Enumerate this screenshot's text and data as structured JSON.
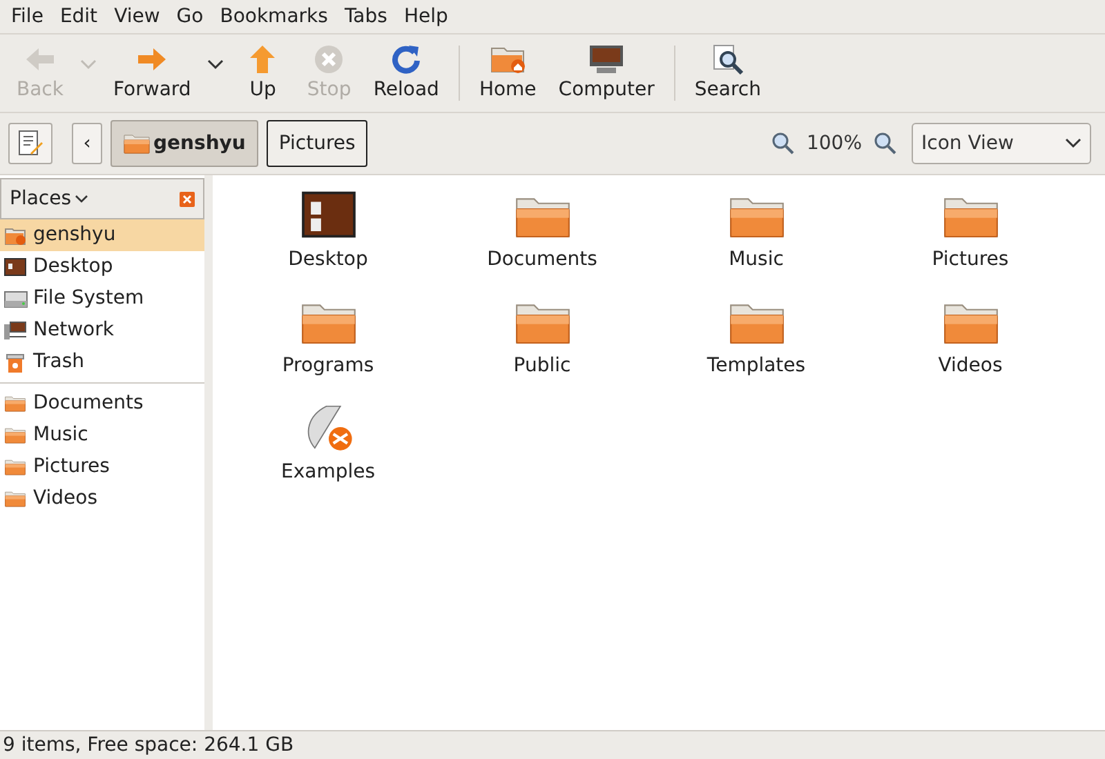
{
  "menu": [
    "File",
    "Edit",
    "View",
    "Go",
    "Bookmarks",
    "Tabs",
    "Help"
  ],
  "toolbar": [
    {
      "kind": "back",
      "label": "Back",
      "disabled": true,
      "dropdown": true
    },
    {
      "kind": "forward",
      "label": "Forward",
      "disabled": false,
      "dropdown": true
    },
    {
      "kind": "up",
      "label": "Up",
      "disabled": false,
      "dropdown": false
    },
    {
      "kind": "stop",
      "label": "Stop",
      "disabled": true,
      "dropdown": false
    },
    {
      "kind": "reload",
      "label": "Reload",
      "disabled": false,
      "dropdown": false
    },
    {
      "kind": "home",
      "label": "Home",
      "disabled": false,
      "dropdown": false
    },
    {
      "kind": "computer",
      "label": "Computer",
      "disabled": false,
      "dropdown": false
    },
    {
      "kind": "search",
      "label": "Search",
      "disabled": false,
      "dropdown": false
    }
  ],
  "location": {
    "back_arrow": "‹",
    "crumbs": [
      {
        "label": "genshyu",
        "selected": true
      },
      {
        "label": "Pictures",
        "selected": false
      }
    ],
    "zoom": "100%",
    "view": "Icon View"
  },
  "sidebar": {
    "title": "Places",
    "items": [
      {
        "kind": "home",
        "label": "genshyu",
        "selected": true
      },
      {
        "kind": "desktop",
        "label": "Desktop",
        "selected": false
      },
      {
        "kind": "drive",
        "label": "File System",
        "selected": false
      },
      {
        "kind": "network",
        "label": "Network",
        "selected": false
      },
      {
        "kind": "trash",
        "label": "Trash",
        "selected": false
      }
    ],
    "bookmarks": [
      {
        "label": "Documents",
        "selected": false
      },
      {
        "label": "Music",
        "selected": false
      },
      {
        "label": "Pictures",
        "selected": false
      },
      {
        "label": "Videos",
        "selected": false
      }
    ]
  },
  "files": [
    {
      "kind": "desktop",
      "label": "Desktop"
    },
    {
      "kind": "folder",
      "label": "Documents"
    },
    {
      "kind": "folder",
      "label": "Music"
    },
    {
      "kind": "folder",
      "label": "Pictures"
    },
    {
      "kind": "folder",
      "label": "Programs"
    },
    {
      "kind": "folder",
      "label": "Public"
    },
    {
      "kind": "folder",
      "label": "Templates"
    },
    {
      "kind": "folder",
      "label": "Videos"
    },
    {
      "kind": "link",
      "label": "Examples"
    }
  ],
  "status_bar": "9 items, Free space: 264.1 GB"
}
